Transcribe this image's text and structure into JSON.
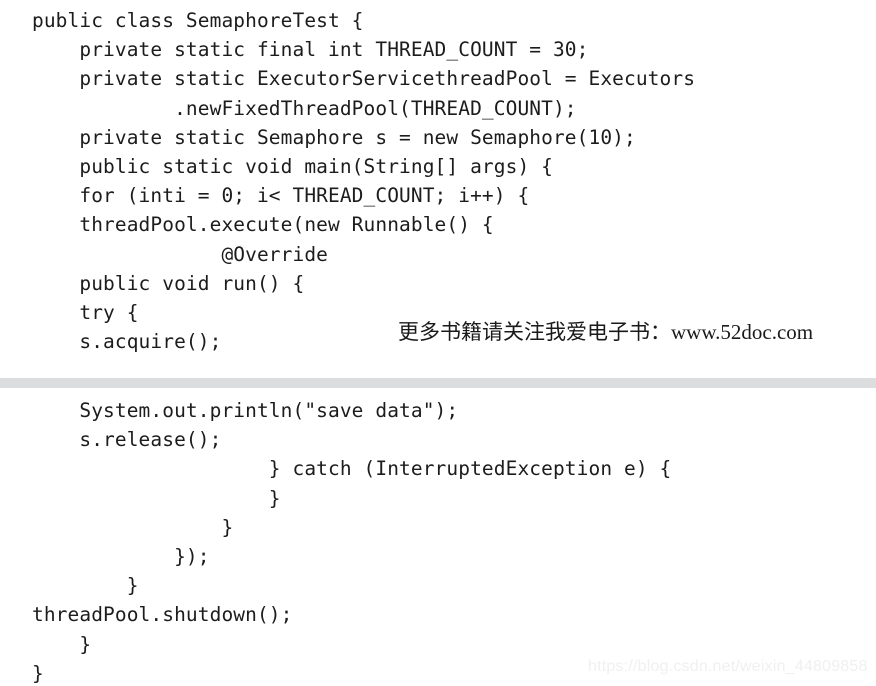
{
  "document": {
    "language": "java",
    "class_name": "SemaphoreTest",
    "code_top_lines": [
      "public class SemaphoreTest {",
      "    private static final int THREAD_COUNT = 30;",
      "    private static ExecutorServicethreadPool = Executors",
      "            .newFixedThreadPool(THREAD_COUNT);",
      "    private static Semaphore s = new Semaphore(10);",
      "    public static void main(String[] args) {",
      "    for (inti = 0; i< THREAD_COUNT; i++) {",
      "    threadPool.execute(new Runnable() {",
      "                @Override",
      "    public void run() {",
      "    try {",
      "    s.acquire();"
    ],
    "code_bottom_lines": [
      "    System.out.println(\"save data\");",
      "    s.release();",
      "                    } catch (InterruptedException e) {",
      "                    }",
      "                }",
      "            });",
      "        }",
      "threadPool.shutdown();",
      "    }",
      "}"
    ]
  },
  "watermarks": {
    "book_promo": "更多书籍请关注我爱电子书：www.52doc.com",
    "blog_url": "https://blog.csdn.net/weixin_44809858"
  },
  "colors": {
    "page_background": "#ffffff",
    "code_text": "#1c1c1c",
    "divider": "#dcdddf",
    "book_watermark_text": "#1a1a1a",
    "blog_watermark_text": "#f0f0f0"
  }
}
